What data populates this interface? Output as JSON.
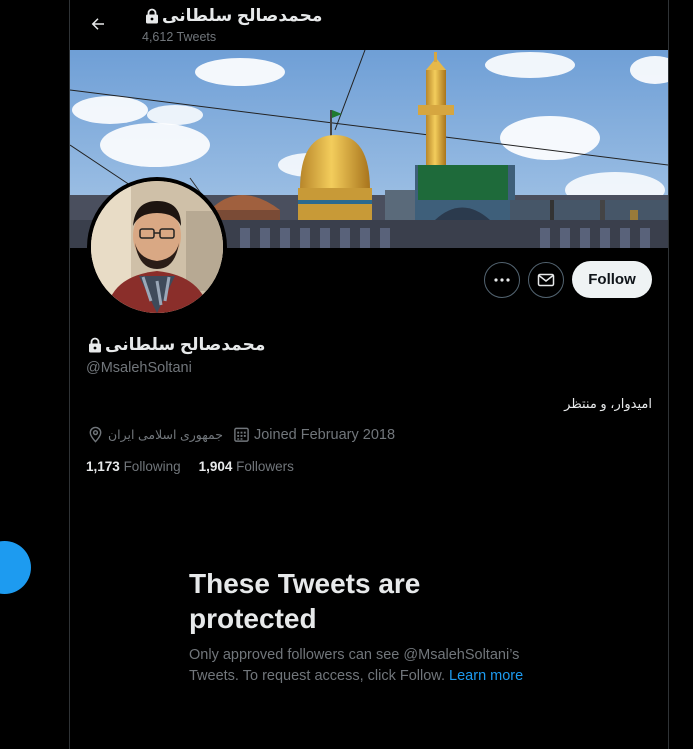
{
  "header": {
    "display_name": "محمدصالح سلطانی",
    "tweet_count": "4,612 Tweets"
  },
  "profile": {
    "display_name": "محمدصالح سلطانی",
    "handle": "@MsalehSoltani",
    "bio": "امیدوار، و منتظر",
    "location": "جمهوری اسلامی ایران",
    "joined": "Joined February 2018",
    "following_count": "1,173",
    "following_label": "Following",
    "followers_count": "1,904",
    "followers_label": "Followers"
  },
  "actions": {
    "follow_label": "Follow"
  },
  "protected": {
    "title": "These Tweets are protected",
    "body": "Only approved followers can see @MsalehSoltani’s Tweets. To request access, click Follow.",
    "link": "Learn more"
  },
  "colors": {
    "background": "#000000",
    "accent": "#1d9bf0",
    "muted": "#71767b",
    "border": "#2f3336"
  }
}
